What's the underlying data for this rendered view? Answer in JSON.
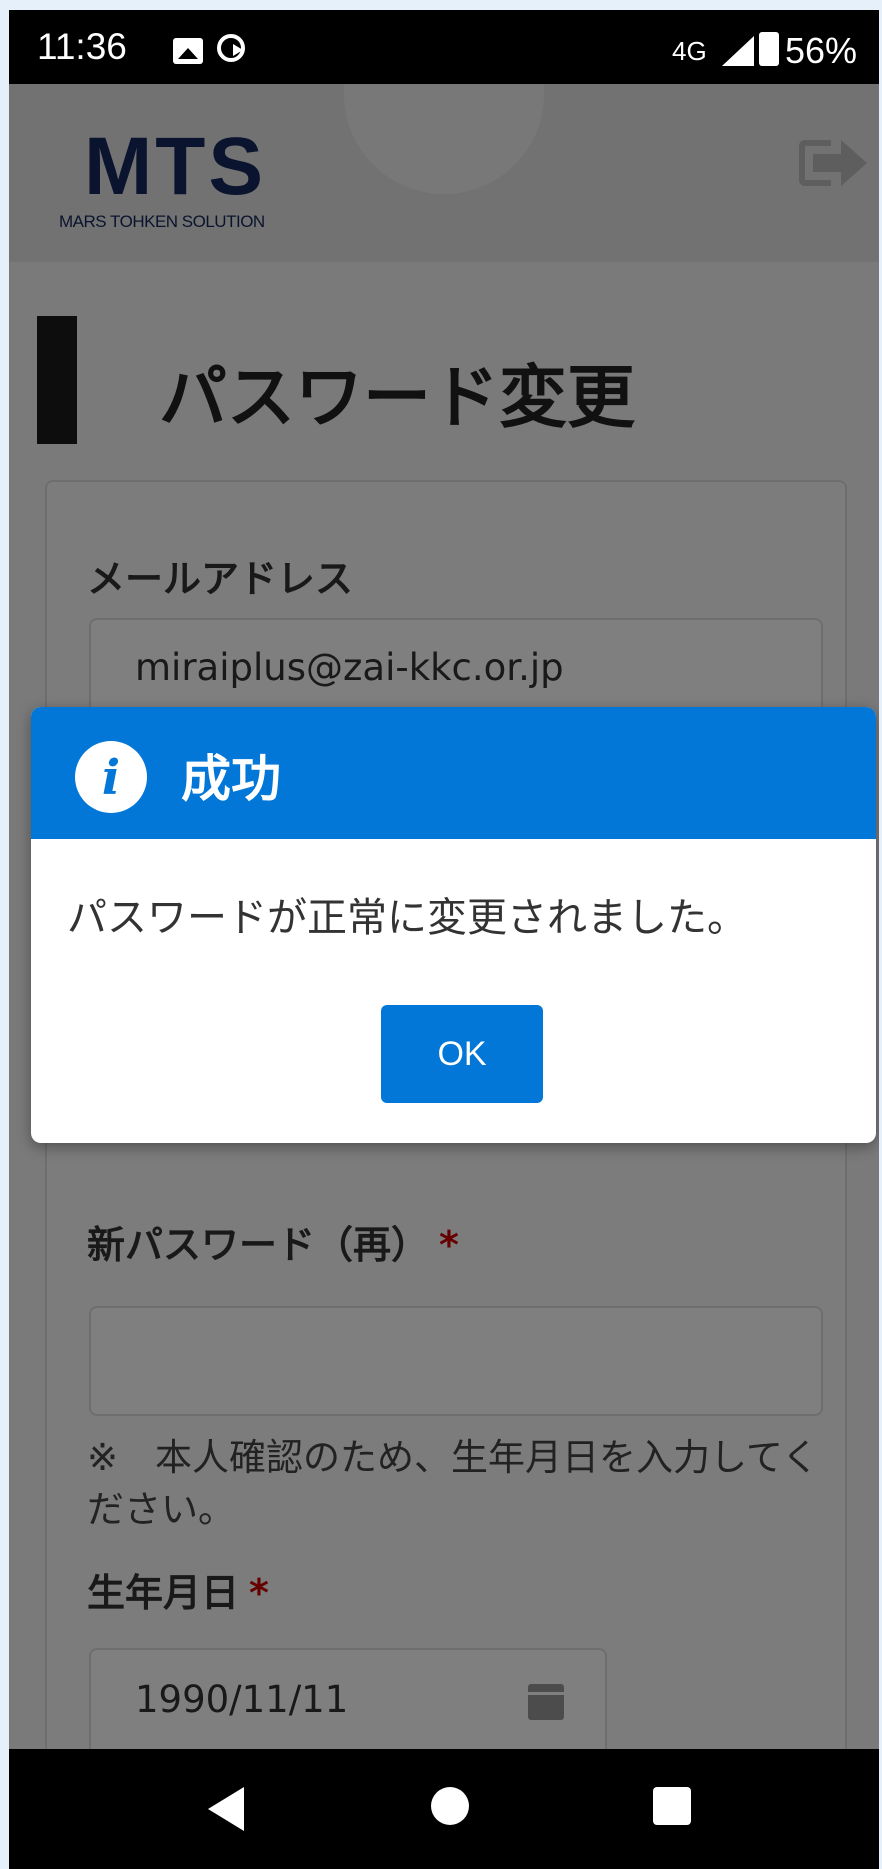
{
  "status_bar": {
    "time": "11:36",
    "network": "4G",
    "battery": "56%"
  },
  "header": {
    "logo_mark": "MTS",
    "logo_text": "MARS TOHKEN SOLUTION"
  },
  "page": {
    "title": "パスワード変更"
  },
  "form": {
    "email_label": "メールアドレス",
    "email_value": "miraiplus@zai-kkc.or.jp",
    "new_password_confirm_label": "新パスワード（再）",
    "required_mark": "*",
    "note": "※　本人確認のため、生年月日を入力してください。",
    "birthdate_label": "生年月日",
    "birthdate_value": "1990/11/11"
  },
  "dialog": {
    "title": "成功",
    "message": "パスワードが正常に変更されました。",
    "ok_label": "OK",
    "accent": "#0277d8"
  },
  "icons": [
    "image-icon",
    "sync-icon",
    "signal-icon",
    "battery-icon",
    "logout-icon",
    "calendar-icon",
    "info-icon",
    "back-icon",
    "home-icon",
    "recents-icon"
  ]
}
